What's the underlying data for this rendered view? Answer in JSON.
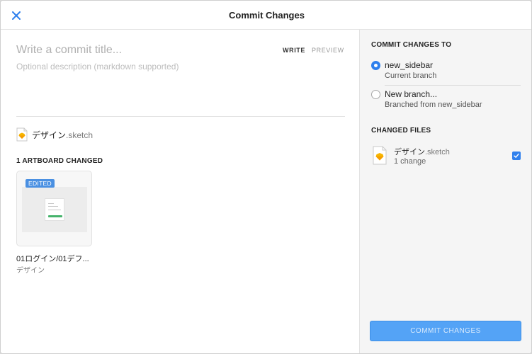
{
  "header": {
    "title": "Commit Changes"
  },
  "editor": {
    "title_placeholder": "Write a commit title...",
    "title_value": "",
    "description_placeholder": "Optional description (markdown supported)",
    "description_value": "",
    "tabs": [
      {
        "label": "WRITE",
        "active": true
      },
      {
        "label": "PREVIEW",
        "active": false
      }
    ]
  },
  "file": {
    "name": "デザイン",
    "ext": ".sketch"
  },
  "artboards": {
    "title": "1 ARTBOARD CHANGED",
    "items": [
      {
        "badge": "EDITED",
        "name": "01ログイン/01デフ...",
        "page": "デザイン"
      }
    ]
  },
  "commit_target": {
    "title": "COMMIT CHANGES TO",
    "options": [
      {
        "label": "new_sidebar",
        "sub": "Current branch",
        "selected": true
      },
      {
        "label": "New branch...",
        "sub": "Branched from new_sidebar",
        "selected": false
      }
    ]
  },
  "changed_files": {
    "title": "CHANGED FILES",
    "items": [
      {
        "name": "デザイン",
        "ext": ".sketch",
        "sub": "1 change",
        "checked": true
      }
    ]
  },
  "actions": {
    "commit_label": "COMMIT CHANGES"
  },
  "colors": {
    "accent": "#2f80ed",
    "button": "#54a3f6",
    "badge": "#4a90e2",
    "sketch_orange": "#f7b500",
    "success": "#45b36b"
  },
  "icons": {
    "close": "close-icon",
    "sketch": "sketch-file-icon",
    "check": "check-icon"
  }
}
